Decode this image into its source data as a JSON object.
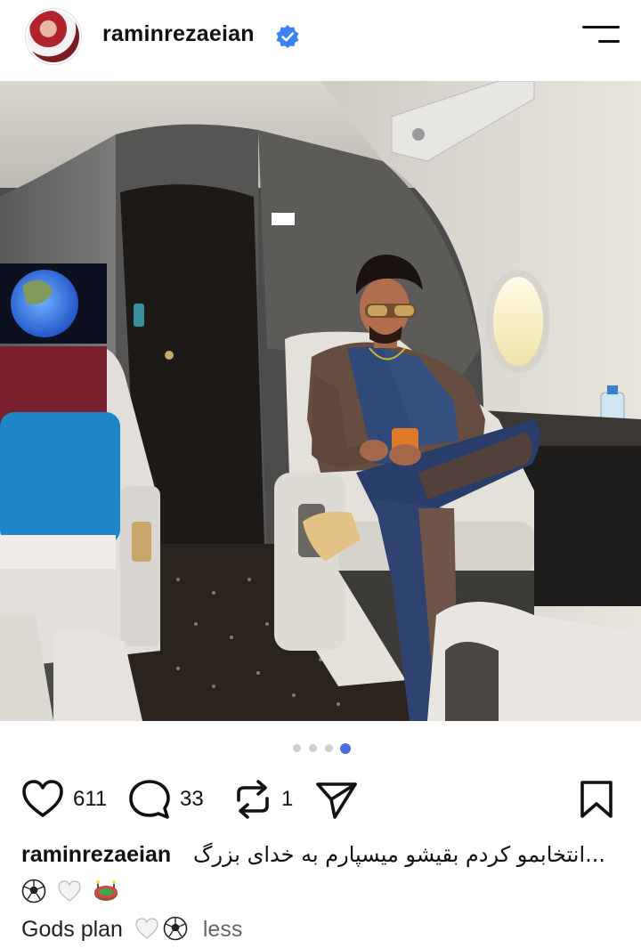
{
  "header": {
    "username": "raminrezaeian",
    "verified_icon": "verified-badge-icon",
    "menu_icon": "hamburger-menu-icon"
  },
  "carousel": {
    "total": 4,
    "active_index": 3
  },
  "actions": {
    "likes": "611",
    "comments": "33",
    "reposts": "1",
    "like_icon": "heart-icon",
    "comment_icon": "comment-bubble-icon",
    "repost_icon": "repost-icon",
    "share_icon": "send-icon",
    "save_icon": "bookmark-icon"
  },
  "caption": {
    "username": "raminrezaeian",
    "text_rtl": "...انتخابمو کردم بقیشو میسپارم به خدای بزرگ",
    "emoji_line": "⚽🤍🏟",
    "text_en": "Gods plan",
    "text_en_emoji": "🤍⚽",
    "less_label": "less"
  },
  "colors": {
    "accent": "#4b6de0",
    "verified": "#3b82f6",
    "text": "#111111",
    "muted": "#666666"
  }
}
